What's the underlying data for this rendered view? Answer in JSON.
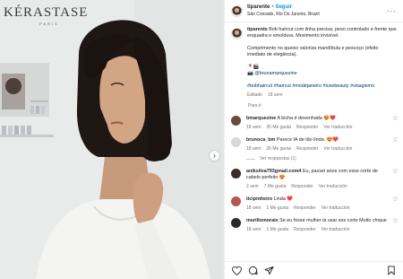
{
  "media": {
    "brand": "KÉRASTASE",
    "brand_sub": "PARIS",
    "next_icon": "chevron-right-icon"
  },
  "header": {
    "username": "tiparente",
    "dot": "•",
    "follow_label": "Seguir",
    "location": "São Conrado, Rio De Janeiro, Brazil",
    "more_icon": "more-horizontal-icon",
    "more_label": "···"
  },
  "caption": {
    "username": "tiparente",
    "line1": "Bob haircut com linha precisa, peso controlado e frente que enquadra e emoldura. Movimento invisível.",
    "line2": "Comprimento no queixo valoriza mandíbula e pescoço (efeito imediato de elegância).",
    "credits_emojis": "📍🎬",
    "mention": "@brunamarquezine",
    "hashtags": "#bobhaircut #haircut #modejaneiro #luxebeauty #visagismo",
    "edited": "Editado",
    "time": "18 sem"
  },
  "translate_prompt": "Para ti",
  "comments": [
    {
      "user": "bmarquezine",
      "text": "A bicha é desenhada",
      "emoji": "😍❤️",
      "time": "18 sem",
      "likes": "35 Me gusta",
      "reply": "Responder",
      "translate": "Ver traducción",
      "avatar_color": "#6b4a3a"
    },
    {
      "user": "brunoca_bm",
      "text": "Parece IA de tão linda.",
      "emoji": "😍❤️",
      "time": "18 sem",
      "likes": "26 Me gusta",
      "reply": "Responder",
      "translate": "Ver traducción",
      "avatar_color": "#d8d8d8",
      "replies": "Ver respuestas (1)"
    },
    {
      "user": "aniksilva793gmail.com4",
      "text": "Eu, passei anos com esse corte de cabelo perfeito",
      "emoji": "😍",
      "time": "2 sem",
      "likes": "7 Me gusta",
      "reply": "Responder",
      "translate": "Ver traducción",
      "avatar_color": "#3d2b24"
    },
    {
      "user": "ticipinheiro",
      "text": "Linda",
      "emoji": "❤️",
      "time": "18 sem",
      "likes": "1 Me gusta",
      "reply": "Responder",
      "translate": "Ver traducción",
      "avatar_color": "#b4584e"
    },
    {
      "user": "murillomorais",
      "text": "Se eu fosse mulher iá usar ess corte Muito chique",
      "emoji": "",
      "time": "18 sem",
      "likes": "1 Me gusta",
      "reply": "Responder",
      "translate": "Ver traducción",
      "avatar_color": "#2e2a2a"
    }
  ],
  "actions": {
    "like_icon": "heart-icon",
    "comment_icon": "comment-icon",
    "share_icon": "send-icon",
    "save_icon": "bookmark-icon"
  }
}
